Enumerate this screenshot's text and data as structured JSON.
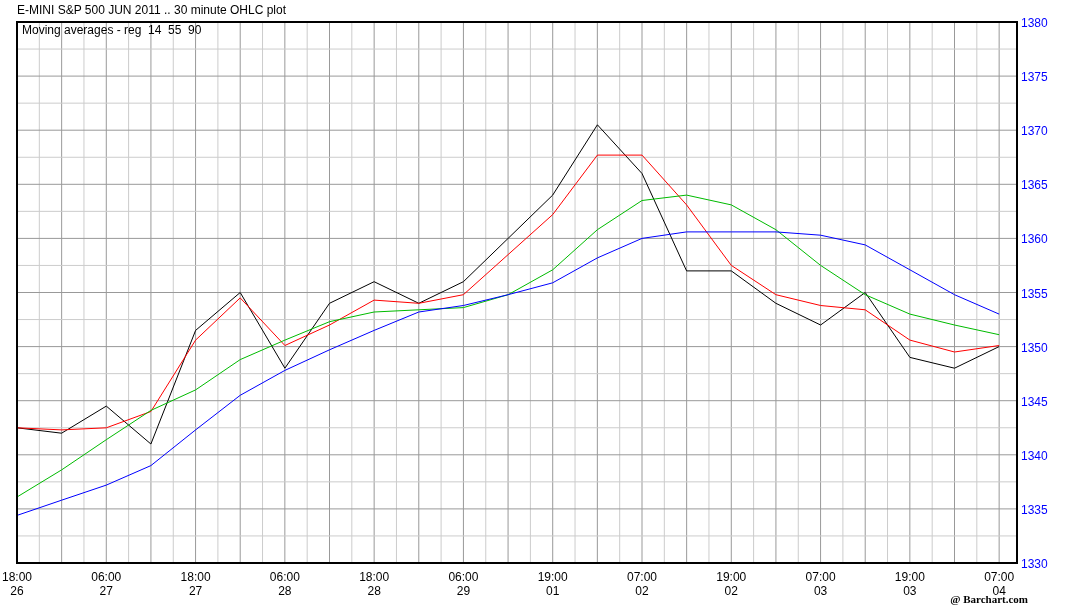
{
  "chart": {
    "title": "E-MINI S&P 500 JUN 2011 .. 30 minute OHLC plot",
    "legend": "Moving averages - reg  14  55  90",
    "credit": "@ Barchart.com",
    "chart_data": {
      "type": "line",
      "categories": [
        "18:00 26",
        null,
        "06:00 27",
        null,
        "18:00 27",
        null,
        "06:00 28",
        null,
        "18:00 28",
        null,
        "06:00 29",
        null,
        "19:00 01",
        null,
        "07:00 02",
        null,
        "19:00 02",
        null,
        "07:00 03",
        null,
        "19:00 03",
        null,
        "07:00 04"
      ],
      "series": [
        {
          "color": "#000000",
          "values": [
            1342.5,
            1342,
            1344.5,
            1341,
            1351.5,
            1355,
            1348,
            1354,
            1356,
            1354,
            1356,
            1360,
            1364,
            1370.5,
            1366,
            1357,
            1357,
            1354,
            1352,
            1355,
            1349,
            1348,
            1350
          ]
        },
        {
          "color": "#ff0000",
          "values": [
            1342.5,
            1342.3,
            1342.5,
            1344,
            1350.6,
            1354.5,
            1350.1,
            1352,
            1354.3,
            1354,
            1354.8,
            1358.5,
            1362.2,
            1367.7,
            1367.7,
            1363.1,
            1357.5,
            1354.8,
            1353.8,
            1353.4,
            1350.6,
            1349.5,
            1350.1
          ]
        },
        {
          "color": "#00bb00",
          "values": [
            1336.1,
            1338.6,
            1341.4,
            1344.1,
            1346,
            1348.8,
            1350.6,
            1352.3,
            1353.2,
            1353.4,
            1353.6,
            1354.8,
            1357.1,
            1360.8,
            1363.5,
            1364,
            1363.1,
            1360.8,
            1357.5,
            1354.8,
            1353,
            1352,
            1351.1
          ]
        },
        {
          "color": "#0000ff",
          "values": [
            1334.4,
            1335.8,
            1337.2,
            1339,
            1342.3,
            1345.5,
            1347.8,
            1349.7,
            1351.5,
            1353.2,
            1353.8,
            1354.8,
            1355.9,
            1358.2,
            1360,
            1360.6,
            1360.6,
            1360.6,
            1360.3,
            1359.4,
            1357.1,
            1354.8,
            1353
          ]
        }
      ],
      "ylim": [
        1330,
        1380
      ],
      "grid": true,
      "yticks": [
        1330,
        1335,
        1340,
        1345,
        1350,
        1355,
        1360,
        1365,
        1370,
        1375,
        1380
      ]
    }
  }
}
